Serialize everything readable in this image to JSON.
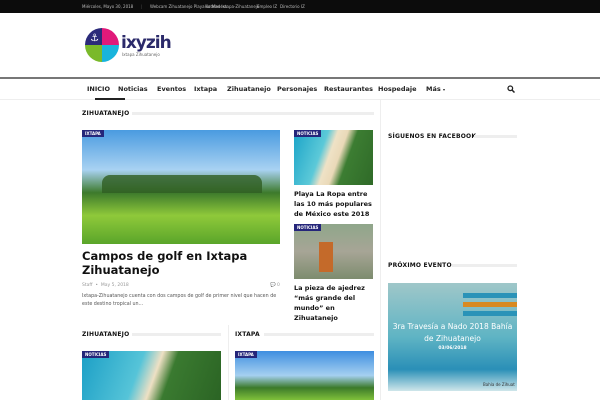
{
  "topbar": {
    "date": "Miércoles, Mayo 30, 2018",
    "links": [
      "Webcam Zihuatanejo Playa La Madera",
      "Hoteles Ixtapa-Zihuatanejo",
      "Empleo IZ",
      "Directorio IZ"
    ]
  },
  "logo": {
    "name": "ixyzih",
    "tagline": "Ixtapa Zihuatanejo"
  },
  "nav": {
    "items": [
      "INICIO",
      "Noticias",
      "Eventos",
      "Ixtapa",
      "Zihuatanejo",
      "Personajes",
      "Restaurantes",
      "Hospedaje",
      "Más"
    ],
    "more_caret": "▾",
    "search_icon": "search-icon"
  },
  "main": {
    "section1": "ZIHUATANEJO",
    "featured": {
      "badge": "IXTAPA",
      "title": "Campos de golf en Ixtapa Zihuatanejo",
      "author": "Staff",
      "date": "May 5, 2018",
      "comments": "0",
      "excerpt": "Ixtapa-Zihuatanejo cuenta con dos campos de golf de primer nivel que hacen de este destino tropical un..."
    },
    "side_posts": [
      {
        "badge": "NOTICIAS",
        "title": "Playa La Ropa entre las 10 más populares de México este 2018"
      },
      {
        "badge": "NOTICIAS",
        "title": "La pieza de ajedrez “más grande del mundo” en Zihuatanejo"
      }
    ],
    "section2": {
      "title": "ZIHUATANEJO",
      "badge": "NOTICIAS"
    },
    "section3": {
      "title": "IXTAPA",
      "badge": "IXTAPA"
    }
  },
  "sidebar": {
    "facebook_title": "SÍGUENOS EN FACEBOOK",
    "event_title": "PRÓXIMO EVENTO",
    "event": {
      "title": "3ra Travesía a Nado 2018 Bahía de Zihuatanejo",
      "date": "03/06/2018",
      "footer": "Bahía de Zihuat"
    }
  },
  "colors": {
    "badge": "#25267a",
    "topbar": "#0c0c0c"
  }
}
